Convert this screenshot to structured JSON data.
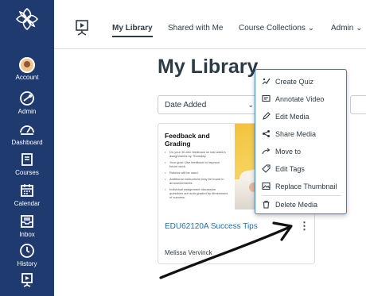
{
  "global_nav": {
    "items": [
      {
        "label": "Account",
        "icon": "avatar-icon"
      },
      {
        "label": "Admin",
        "icon": "admin-icon"
      },
      {
        "label": "Dashboard",
        "icon": "dashboard-icon"
      },
      {
        "label": "Courses",
        "icon": "courses-icon"
      },
      {
        "label": "Calendar",
        "icon": "calendar-icon"
      },
      {
        "label": "Inbox",
        "icon": "inbox-icon"
      },
      {
        "label": "History",
        "icon": "history-icon"
      }
    ],
    "bg_color": "#1f3a6e"
  },
  "top_tabs": [
    {
      "label": "My Library"
    },
    {
      "label": "Shared with Me"
    },
    {
      "label": "Course Collections",
      "chevron": "chevron-down-icon"
    },
    {
      "label": "Admin",
      "chevron": "chevron-down-icon"
    }
  ],
  "page_title": "My Library",
  "sort_select": {
    "value": "Date Added"
  },
  "media_card": {
    "thumbnail": {
      "title": "Feedback and Grading",
      "bullets": [
        "Do your 30-min feedback on last week's assignments by Thursday.",
        "Your goal: Use feedback to improve future work.",
        "Rubrics will be used.",
        "Additional instructions may be found in announcements.",
        "Individual assignment discussion questions are auto-graded by dimensions of success."
      ]
    },
    "title": "EDU62120A Success Tips",
    "author": "Melissa Vervinck",
    "link_color": "#1c6fb5"
  },
  "context_menu": {
    "items": [
      {
        "label": "Create Quiz",
        "icon": "quiz-icon"
      },
      {
        "label": "Annotate Video",
        "icon": "annotate-icon"
      },
      {
        "label": "Edit Media",
        "icon": "edit-icon"
      },
      {
        "label": "Share Media",
        "icon": "share-icon"
      },
      {
        "label": "Move to",
        "icon": "move-icon"
      },
      {
        "label": "Edit Tags",
        "icon": "tag-icon"
      },
      {
        "label": "Replace Thumbnail",
        "icon": "image-icon"
      },
      {
        "label": "Delete Media",
        "icon": "trash-icon"
      }
    ],
    "border_color": "#3b7dc6"
  }
}
